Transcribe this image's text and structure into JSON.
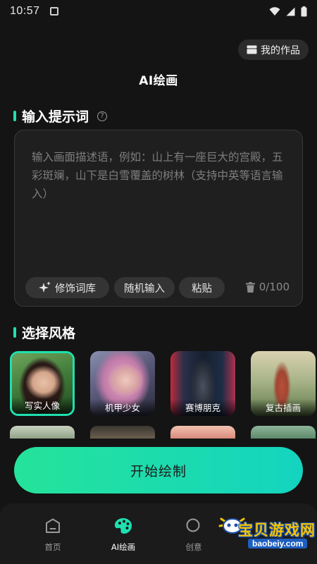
{
  "status_bar": {
    "time": "10:57"
  },
  "header": {
    "works_button_label": "我的作品",
    "title": "AI绘画"
  },
  "prompt_section": {
    "title": "输入提示词",
    "placeholder": "输入画面描述语，例如：山上有一座巨大的宫殿，五彩斑斓，山下是白雪覆盖的树林（支持中英等语言输入）",
    "chips": [
      "修饰词库",
      "随机输入",
      "粘贴"
    ],
    "counter": "0/100"
  },
  "style_section": {
    "title": "选择风格",
    "styles": [
      {
        "label": "写实人像",
        "selected": true
      },
      {
        "label": "机甲少女",
        "selected": false
      },
      {
        "label": "赛博朋克",
        "selected": false
      },
      {
        "label": "复古插画",
        "selected": false
      }
    ]
  },
  "start_button_label": "开始绘制",
  "tab_bar": {
    "items": [
      {
        "label": "首页",
        "icon": "home-icon",
        "active": false
      },
      {
        "label": "AI绘画",
        "icon": "palette-icon",
        "active": true
      },
      {
        "label": "创意",
        "icon": "creative-icon",
        "active": false
      }
    ]
  },
  "watermark": {
    "text": "宝贝游戏网",
    "url": "baobeiy.com"
  },
  "colors": {
    "accent": "#1fe0b0",
    "background": "#141414",
    "button_gradient_start": "#25e39a",
    "button_gradient_end": "#14d4c0"
  }
}
